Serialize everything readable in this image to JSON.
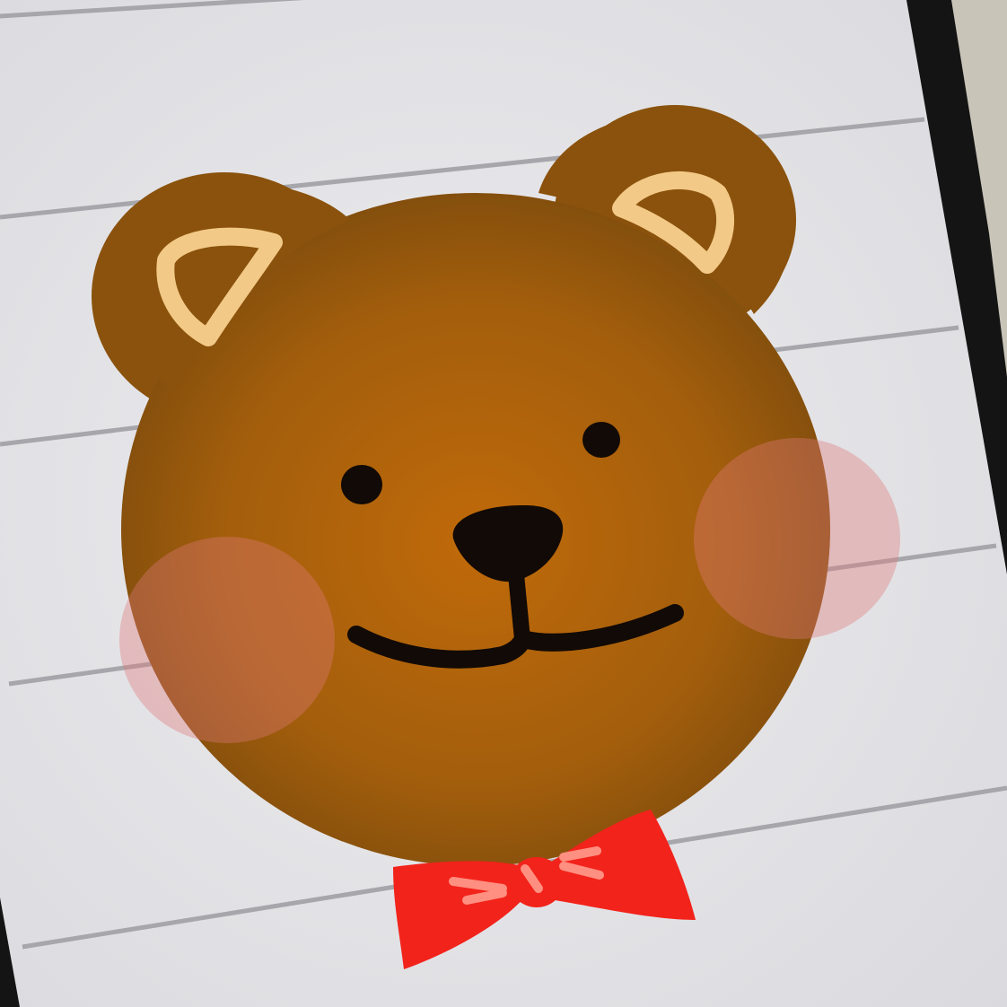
{
  "scene": {
    "subject": "bear-face-drawing",
    "colors": {
      "screen": "#e4e4e7",
      "screen_lines": "#a6a6ab",
      "device_bezel": "#141414",
      "device_edge": "#c9c4b8",
      "fur_light": "#c06a0a",
      "fur_mid": "#94530c",
      "fur_dark": "#7a4a0c",
      "inner_ear": "#f3c987",
      "cheek_blush": "#e07a7a",
      "features": "#120a06",
      "bow": "#f2231b",
      "bow_highlight": "#ff8f80"
    },
    "icons": [
      "bear-face",
      "bow-tie"
    ]
  }
}
